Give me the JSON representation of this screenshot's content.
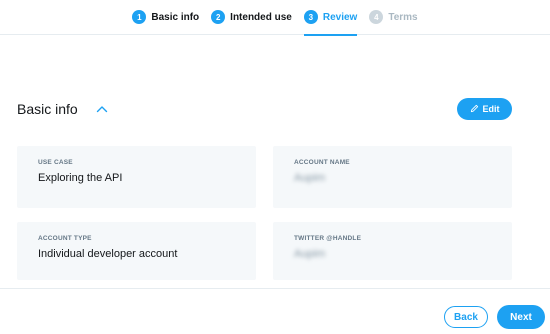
{
  "stepper": {
    "steps": [
      {
        "number": "1",
        "label": "Basic info",
        "state": "completed"
      },
      {
        "number": "2",
        "label": "Intended use",
        "state": "completed"
      },
      {
        "number": "3",
        "label": "Review",
        "state": "active"
      },
      {
        "number": "4",
        "label": "Terms",
        "state": "disabled"
      }
    ]
  },
  "section": {
    "title": "Basic info",
    "collapse_icon": "chevron-up-icon",
    "edit_icon": "pencil-icon",
    "edit_label": "Edit"
  },
  "cards": {
    "use_case": {
      "label": "USE CASE",
      "value": "Exploring the API"
    },
    "account_name": {
      "label": "ACCOUNT NAME",
      "value": "Aupim"
    },
    "account_type": {
      "label": "ACCOUNT TYPE",
      "value": "Individual developer account"
    },
    "twitter_handle": {
      "label": "TWITTER @HANDLE",
      "value": "Aupim"
    }
  },
  "footer": {
    "back_label": "Back",
    "next_label": "Next"
  },
  "colors": {
    "accent": "#1da1f2",
    "card_bg": "#f5f8fa",
    "disabled": "#ccd6dd"
  }
}
